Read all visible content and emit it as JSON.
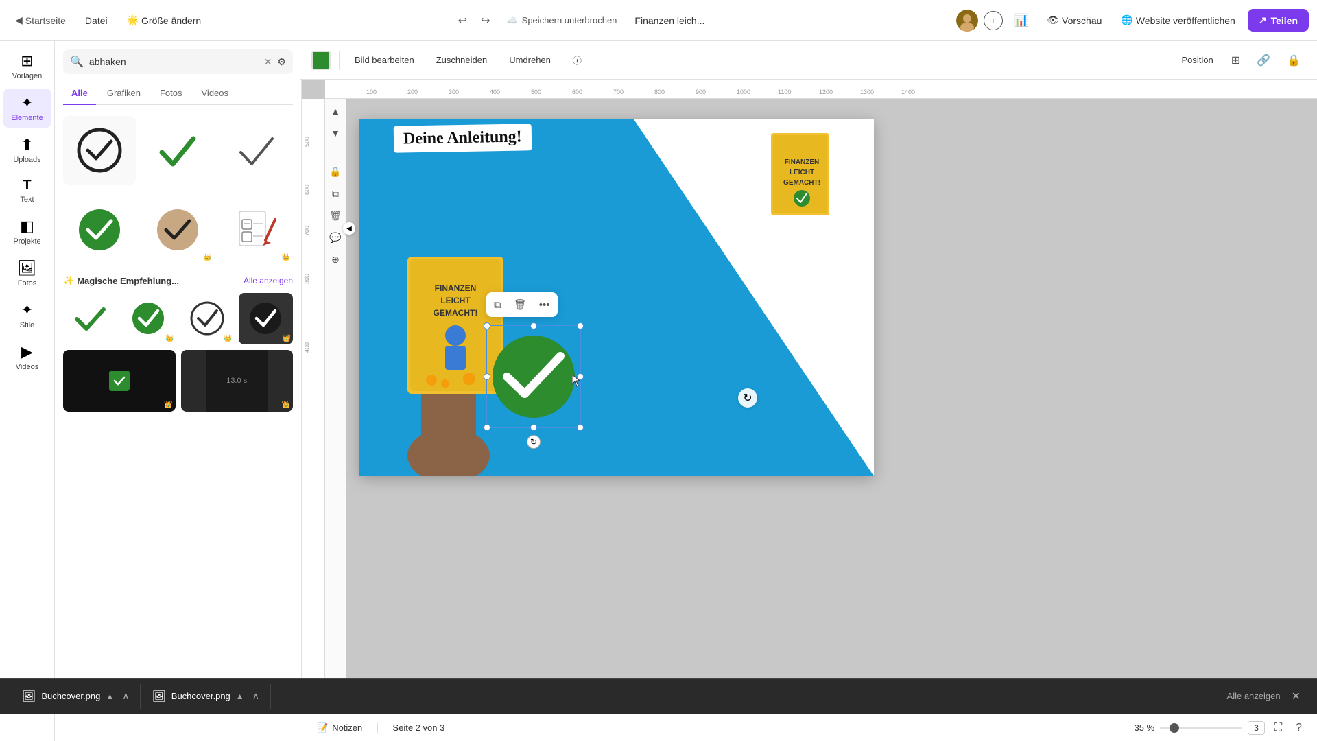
{
  "topbar": {
    "back_label": "Startseite",
    "datei_label": "Datei",
    "size_label": "Größe ändern",
    "undo_icon": "↩",
    "redo_icon": "↪",
    "save_status": "Speichern unterbrochen",
    "project_name": "Finanzen leich...",
    "preview_label": "Vorschau",
    "publish_label": "Website veröffentlichen",
    "share_label": "Teilen",
    "add_icon": "+"
  },
  "toolbar": {
    "edit_image_label": "Bild bearbeiten",
    "crop_label": "Zuschneiden",
    "flip_label": "Umdrehen",
    "info_icon": "ⓘ",
    "position_label": "Position"
  },
  "sidebar": {
    "items": [
      {
        "label": "Vorlagen",
        "icon": "⊞"
      },
      {
        "label": "Elemente",
        "icon": "✦"
      },
      {
        "label": "Uploads",
        "icon": "↑"
      },
      {
        "label": "Text",
        "icon": "T"
      },
      {
        "label": "Projekte",
        "icon": "◧"
      },
      {
        "label": "Fotos",
        "icon": "🖼"
      },
      {
        "label": "Stile",
        "icon": "✦"
      },
      {
        "label": "Videos",
        "icon": "▶"
      }
    ]
  },
  "search": {
    "query": "abhaken",
    "placeholder": "abhaken",
    "tabs": [
      "Alle",
      "Grafiken",
      "Fotos",
      "Videos"
    ],
    "active_tab": "Alle"
  },
  "magic_section": {
    "title": "Magische Empfehlung...",
    "see_all": "Alle anzeigen"
  },
  "bottom_bar": {
    "notes_label": "Notizen",
    "page_label": "Seite 2 von 3",
    "zoom_label": "35 %",
    "zoom_value": 35
  },
  "files_bar": {
    "files": [
      {
        "name": "Buchcover.png",
        "icon": "🖼"
      },
      {
        "name": "Buchcover.png",
        "icon": "🖼"
      }
    ],
    "show_all_label": "Alle anzeigen"
  },
  "canvas": {
    "page_title": "Deine Anleitung!",
    "ruler_marks": [
      "100",
      "200",
      "300",
      "400",
      "500",
      "600",
      "700",
      "800",
      "900",
      "1000",
      "1100",
      "1200",
      "1300",
      "1400"
    ]
  }
}
